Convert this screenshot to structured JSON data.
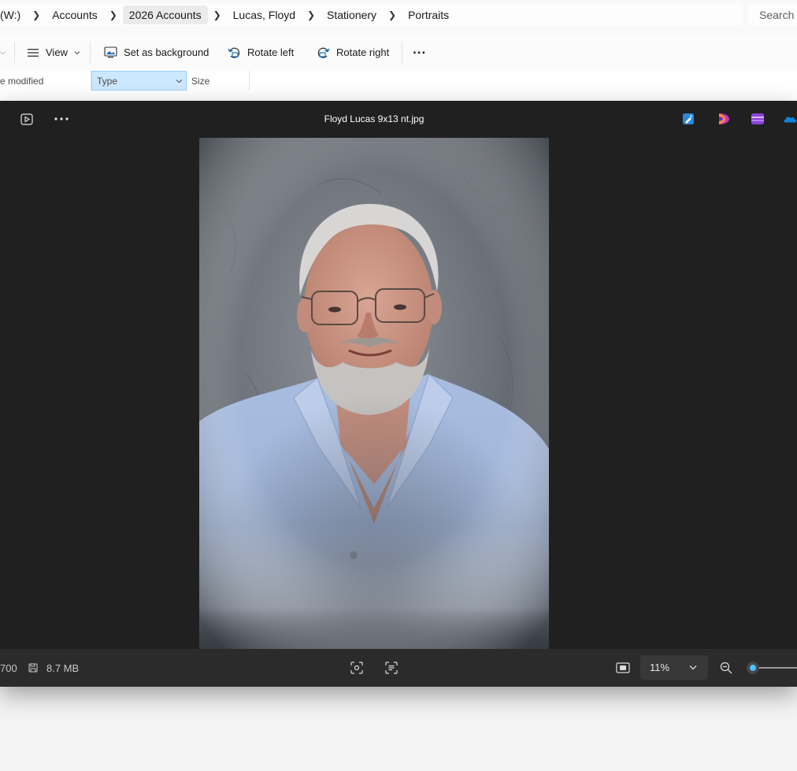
{
  "explorer": {
    "breadcrumbs": [
      "(W:)",
      "Accounts",
      "2026 Accounts",
      "Lucas, Floyd",
      "Stationery",
      "Portraits"
    ],
    "search_placeholder": "Search",
    "commands": {
      "view": "View",
      "set_background": "Set as background",
      "rotate_left": "Rotate left",
      "rotate_right": "Rotate right",
      "more": "..."
    },
    "columns": {
      "date_modified": "e modified",
      "type": "Type",
      "size": "Size"
    }
  },
  "viewer": {
    "file_name": "Floyd Lucas 9x13 nt.jpg",
    "status": {
      "dimensions_partial": "700",
      "file_size": "8.7 MB"
    },
    "zoom": {
      "label": "11%",
      "level": 0.11
    },
    "icons": [
      "slideshow-icon",
      "more-icon",
      "edit-icon",
      "clipchamp-icon",
      "video-editor-icon",
      "onedrive-icon",
      "fit-icon",
      "ocr-icon",
      "actual-size-icon",
      "zoom-out-icon"
    ]
  },
  "colors": {
    "viewer_bg": "#202020",
    "statusbar_bg": "#2b2b2b",
    "accent": "#4cc2ff",
    "type_column_highlight": "#cce8ff"
  }
}
